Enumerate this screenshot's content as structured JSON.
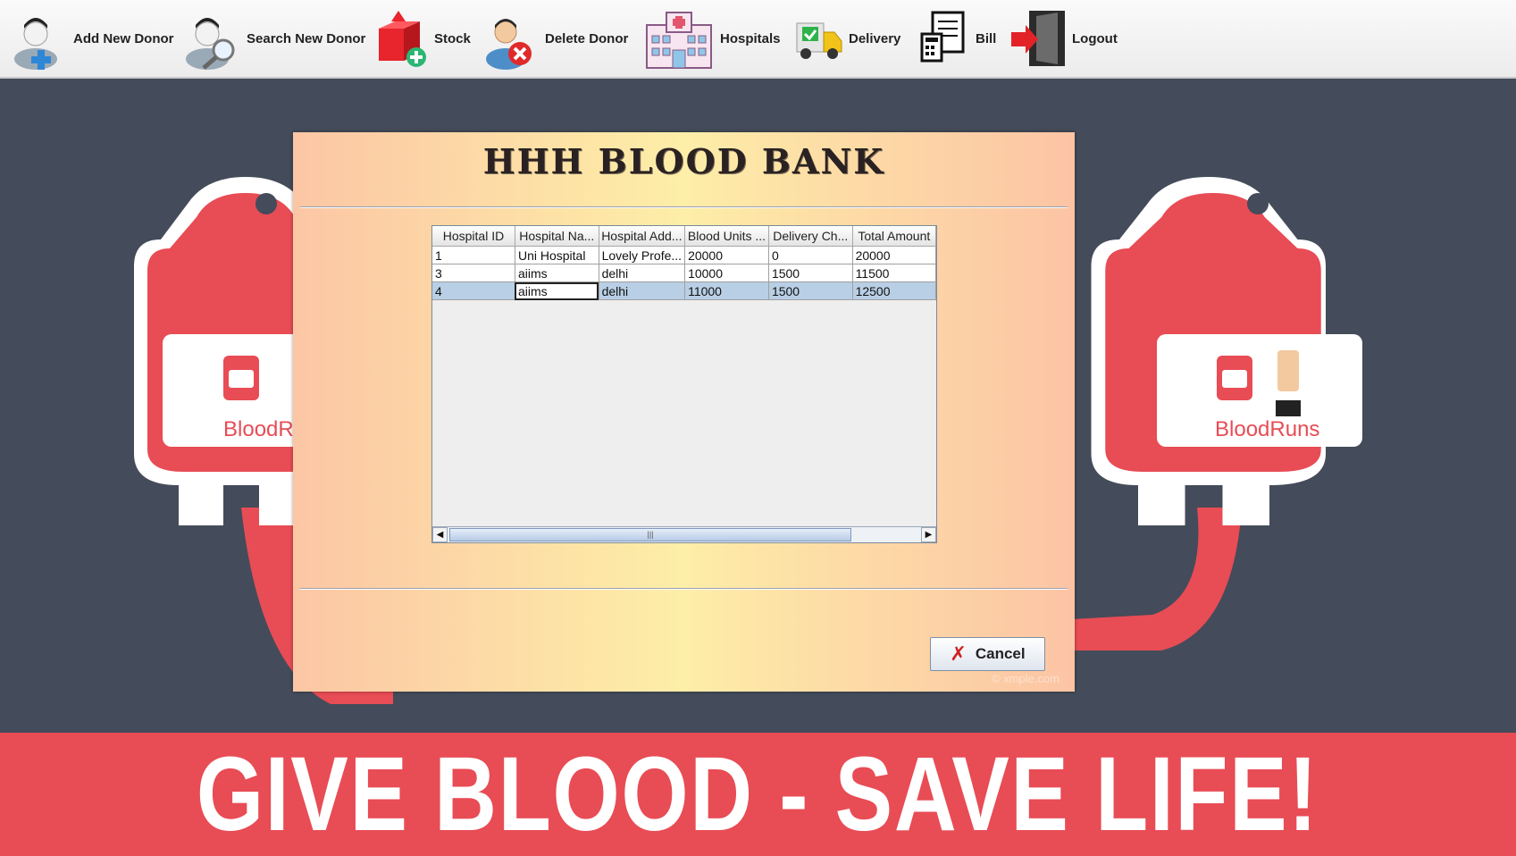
{
  "toolbar": {
    "items": [
      {
        "label": "Add New Donor",
        "icon": "add-donor-icon"
      },
      {
        "label": "Search New Donor",
        "icon": "search-donor-icon"
      },
      {
        "label": "Stock",
        "icon": "stock-box-icon"
      },
      {
        "label": "Delete Donor",
        "icon": "delete-donor-icon"
      },
      {
        "label": "Hospitals",
        "icon": "hospital-building-icon"
      },
      {
        "label": "Delivery",
        "icon": "delivery-truck-icon"
      },
      {
        "label": "Bill",
        "icon": "bill-calculator-icon"
      },
      {
        "label": "Logout",
        "icon": "logout-door-icon"
      }
    ]
  },
  "background": {
    "logo_text": "BloodRuns",
    "banner_text": "GIVE BLOOD - SAVE LIFE!",
    "bag_color": "#e84c55",
    "backdrop_color": "#444b5a"
  },
  "dialog": {
    "title": "HHH BLOOD BANK",
    "table": {
      "columns": [
        "Hospital ID",
        "Hospital Na...",
        "Hospital Add...",
        "Blood Units ...",
        "Delivery Ch...",
        "Total Amount"
      ],
      "rows": [
        [
          "1",
          "Uni Hospital",
          "Lovely Profe...",
          "20000",
          "0",
          "20000"
        ],
        [
          "3",
          "aiims",
          "delhi",
          "10000",
          "1500",
          "11500"
        ],
        [
          "4",
          "aiims",
          "delhi",
          "11000",
          "1500",
          "12500"
        ]
      ],
      "selected_row": 2
    },
    "cancel_label": "Cancel",
    "watermark": "© xmple.com"
  }
}
